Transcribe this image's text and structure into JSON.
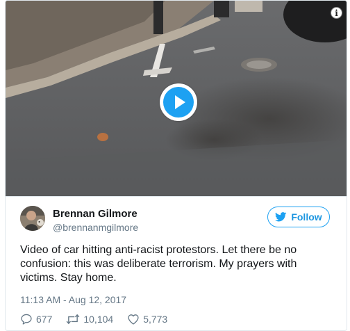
{
  "media": {
    "info_glyph": "i",
    "play_icon": "play-icon"
  },
  "author": {
    "display_name": "Brennan Gilmore",
    "screen_name": "@brennanmgilmore",
    "avatar_icon": "avatar"
  },
  "follow": {
    "label": "Follow",
    "icon": "twitter-bird-icon"
  },
  "tweet": {
    "text": "Video of car hitting anti-racist protestors. Let there be no confusion: this was deliberate terrorism. My prayers with victims. Stay home.",
    "timestamp": "11:13 AM - Aug 12, 2017"
  },
  "actions": {
    "replies": "677",
    "retweets": "10,104",
    "likes": "5,773"
  },
  "colors": {
    "accent": "#1da1f2",
    "link": "#1b95e0",
    "secondary_text": "#657786",
    "border": "#e1e8ed"
  }
}
